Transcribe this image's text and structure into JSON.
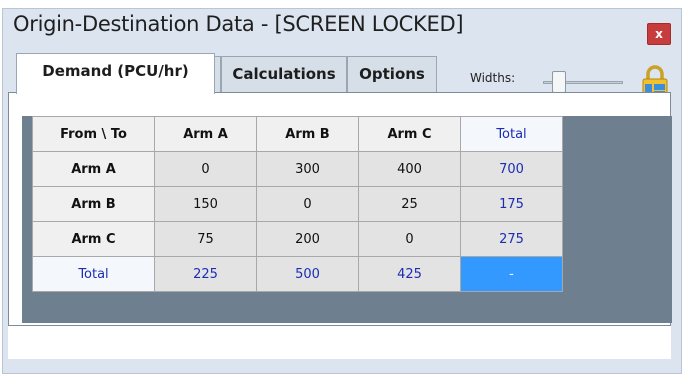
{
  "window": {
    "title": "Origin-Destination Data - [SCREEN LOCKED]",
    "close_label": "x"
  },
  "tabs": [
    {
      "label": "Demand (PCU/hr)",
      "active": true
    },
    {
      "label": "Calculations",
      "active": false
    },
    {
      "label": "Options",
      "active": false
    }
  ],
  "toolbar": {
    "widths_label": "Widths:",
    "lock_icon": "lock-icon"
  },
  "grid": {
    "corner_label": "From \\ To",
    "columns": [
      "Arm A",
      "Arm B",
      "Arm C",
      "Total"
    ],
    "rows": [
      {
        "label": "Arm A",
        "values": [
          "0",
          "300",
          "400"
        ],
        "total": "700"
      },
      {
        "label": "Arm B",
        "values": [
          "150",
          "0",
          "25"
        ],
        "total": "175"
      },
      {
        "label": "Arm C",
        "values": [
          "75",
          "200",
          "0"
        ],
        "total": "275"
      }
    ],
    "totals_row": {
      "label": "Total",
      "values": [
        "225",
        "500",
        "425"
      ],
      "grand": "-"
    }
  },
  "colors": {
    "accent_selected": "#3399ff",
    "total_text": "#1c2db4",
    "close_button": "#c73c3c"
  }
}
